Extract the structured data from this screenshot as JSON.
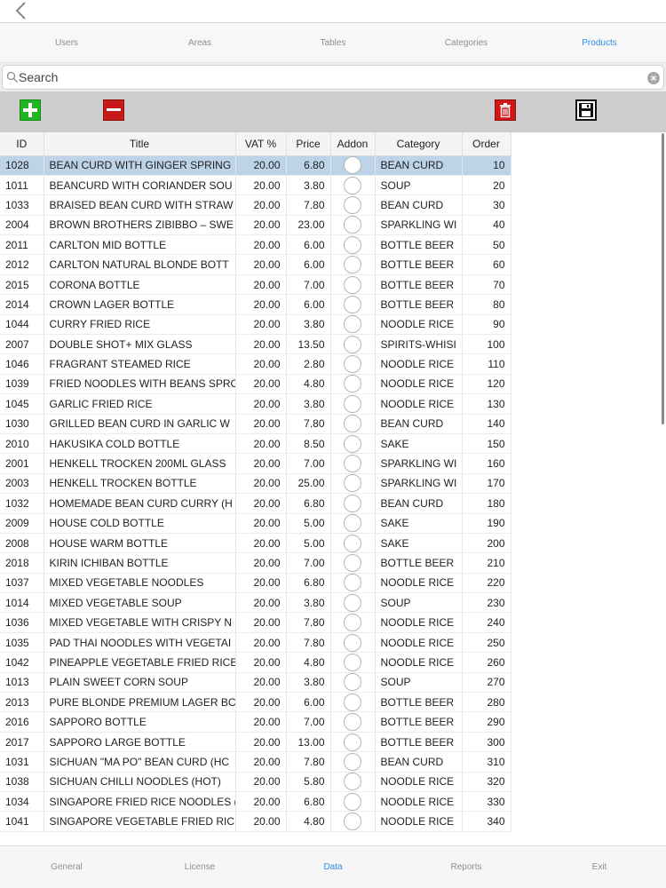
{
  "top_tabs": [
    {
      "label": "Users",
      "active": false
    },
    {
      "label": "Areas",
      "active": false
    },
    {
      "label": "Tables",
      "active": false
    },
    {
      "label": "Categories",
      "active": false
    },
    {
      "label": "Products",
      "active": true
    }
  ],
  "search": {
    "placeholder": "Search",
    "value": ""
  },
  "table": {
    "headers": {
      "id": "ID",
      "title": "Title",
      "vat": "VAT %",
      "price": "Price",
      "addon": "Addon",
      "category": "Category",
      "order": "Order"
    },
    "selected_row": 0,
    "rows": [
      {
        "id": "1028",
        "title": "BEAN CURD WITH GINGER  SPRING",
        "vat": "20.00",
        "price": "6.80",
        "category": "BEAN CURD",
        "order": "10"
      },
      {
        "id": "1011",
        "title": "BEANCURD WITH CORIANDER SOU",
        "vat": "20.00",
        "price": "3.80",
        "category": "SOUP",
        "order": "20"
      },
      {
        "id": "1033",
        "title": "BRAISED BEAN CURD WITH STRAW",
        "vat": "20.00",
        "price": "7.80",
        "category": "BEAN CURD",
        "order": "30"
      },
      {
        "id": "2004",
        "title": "BROWN BROTHERS ZIBIBBO – SWE",
        "vat": "20.00",
        "price": "23.00",
        "category": "SPARKLING WI",
        "order": "40"
      },
      {
        "id": "2011",
        "title": "CARLTON MID BOTTLE",
        "vat": "20.00",
        "price": "6.00",
        "category": "BOTTLE BEER",
        "order": "50"
      },
      {
        "id": "2012",
        "title": "CARLTON NATURAL BLONDE BOTT",
        "vat": "20.00",
        "price": "6.00",
        "category": "BOTTLE BEER",
        "order": "60"
      },
      {
        "id": "2015",
        "title": "CORONA BOTTLE",
        "vat": "20.00",
        "price": "7.00",
        "category": "BOTTLE BEER",
        "order": "70"
      },
      {
        "id": "2014",
        "title": "CROWN LAGER BOTTLE",
        "vat": "20.00",
        "price": "6.00",
        "category": "BOTTLE BEER",
        "order": "80"
      },
      {
        "id": "1044",
        "title": "CURRY FRIED RICE",
        "vat": "20.00",
        "price": "3.80",
        "category": "NOODLE  RICE",
        "order": "90"
      },
      {
        "id": "2007",
        "title": "DOUBLE SHOT+ MIX GLASS",
        "vat": "20.00",
        "price": "13.50",
        "category": "SPIRITS-WHISI",
        "order": "100"
      },
      {
        "id": "1046",
        "title": "FRAGRANT STEAMED RICE",
        "vat": "20.00",
        "price": "2.80",
        "category": "NOODLE  RICE",
        "order": "110"
      },
      {
        "id": "1039",
        "title": "FRIED NOODLES WITH BEANS SPRO",
        "vat": "20.00",
        "price": "4.80",
        "category": "NOODLE  RICE",
        "order": "120"
      },
      {
        "id": "1045",
        "title": "GARLIC FRIED RICE",
        "vat": "20.00",
        "price": "3.80",
        "category": "NOODLE  RICE",
        "order": "130"
      },
      {
        "id": "1030",
        "title": "GRILLED BEAN CURD IN GARLIC  W",
        "vat": "20.00",
        "price": "7.80",
        "category": "BEAN CURD",
        "order": "140"
      },
      {
        "id": "2010",
        "title": "HAKUSIKA COLD BOTTLE",
        "vat": "20.00",
        "price": "8.50",
        "category": "SAKE",
        "order": "150"
      },
      {
        "id": "2001",
        "title": "HENKELL TROCKEN  200ML GLASS",
        "vat": "20.00",
        "price": "7.00",
        "category": "SPARKLING WI",
        "order": "160"
      },
      {
        "id": "2003",
        "title": "HENKELL TROCKEN BOTTLE",
        "vat": "20.00",
        "price": "25.00",
        "category": "SPARKLING WI",
        "order": "170"
      },
      {
        "id": "1032",
        "title": "HOMEMADE BEAN CURD CURRY (H",
        "vat": "20.00",
        "price": "6.80",
        "category": "BEAN CURD",
        "order": "180"
      },
      {
        "id": "2009",
        "title": "HOUSE COLD BOTTLE",
        "vat": "20.00",
        "price": "5.00",
        "category": "SAKE",
        "order": "190"
      },
      {
        "id": "2008",
        "title": "HOUSE WARM BOTTLE",
        "vat": "20.00",
        "price": "5.00",
        "category": "SAKE",
        "order": "200"
      },
      {
        "id": "2018",
        "title": "KIRIN ICHIBAN BOTTLE",
        "vat": "20.00",
        "price": "7.00",
        "category": "BOTTLE BEER",
        "order": "210"
      },
      {
        "id": "1037",
        "title": "MIXED VEGETABLE NOODLES",
        "vat": "20.00",
        "price": "6.80",
        "category": "NOODLE  RICE",
        "order": "220"
      },
      {
        "id": "1014",
        "title": "MIXED VEGETABLE SOUP",
        "vat": "20.00",
        "price": "3.80",
        "category": "SOUP",
        "order": "230"
      },
      {
        "id": "1036",
        "title": "MIXED VEGETABLE WITH CRISPY N",
        "vat": "20.00",
        "price": "7.80",
        "category": "NOODLE  RICE",
        "order": "240"
      },
      {
        "id": "1035",
        "title": "PAD THAI NOODLES WITH VEGETAI",
        "vat": "20.00",
        "price": "7.80",
        "category": "NOODLE  RICE",
        "order": "250"
      },
      {
        "id": "1042",
        "title": "PINEAPPLE  VEGETABLE FRIED RICE",
        "vat": "20.00",
        "price": "4.80",
        "category": "NOODLE  RICE",
        "order": "260"
      },
      {
        "id": "1013",
        "title": "PLAIN SWEET CORN SOUP",
        "vat": "20.00",
        "price": "3.80",
        "category": "SOUP",
        "order": "270"
      },
      {
        "id": "2013",
        "title": "PURE BLONDE PREMIUM LAGER BC",
        "vat": "20.00",
        "price": "6.00",
        "category": "BOTTLE BEER",
        "order": "280"
      },
      {
        "id": "2016",
        "title": "SAPPORO BOTTLE",
        "vat": "20.00",
        "price": "7.00",
        "category": "BOTTLE BEER",
        "order": "290"
      },
      {
        "id": "2017",
        "title": "SAPPORO LARGE BOTTLE",
        "vat": "20.00",
        "price": "13.00",
        "category": "BOTTLE BEER",
        "order": "300"
      },
      {
        "id": "1031",
        "title": "SICHUAN \"MA PO\" BEAN CURD (HC",
        "vat": "20.00",
        "price": "7.80",
        "category": "BEAN CURD",
        "order": "310"
      },
      {
        "id": "1038",
        "title": "SICHUAN CHILLI NOODLES (HOT)",
        "vat": "20.00",
        "price": "5.80",
        "category": "NOODLE  RICE",
        "order": "320"
      },
      {
        "id": "1034",
        "title": "SINGAPORE FRIED RICE NOODLES (",
        "vat": "20.00",
        "price": "6.80",
        "category": "NOODLE  RICE",
        "order": "330"
      },
      {
        "id": "1041",
        "title": "SINGAPORE VEGETABLE FRIED RICI",
        "vat": "20.00",
        "price": "4.80",
        "category": "NOODLE  RICE",
        "order": "340"
      }
    ]
  },
  "bottom_nav": [
    {
      "label": "General",
      "active": false
    },
    {
      "label": "License",
      "active": false
    },
    {
      "label": "Data",
      "active": true
    },
    {
      "label": "Reports",
      "active": false
    },
    {
      "label": "Exit",
      "active": false
    }
  ],
  "colors": {
    "accent": "#2a8ee8",
    "selected_row": "#bcd3e8",
    "add": "#22b422",
    "remove": "#c81919",
    "delete": "#d21616"
  },
  "icons": [
    "back-chevron-icon",
    "search-icon",
    "clear-icon",
    "plus-icon",
    "minus-icon",
    "trash-icon",
    "floppy-disk-icon"
  ]
}
